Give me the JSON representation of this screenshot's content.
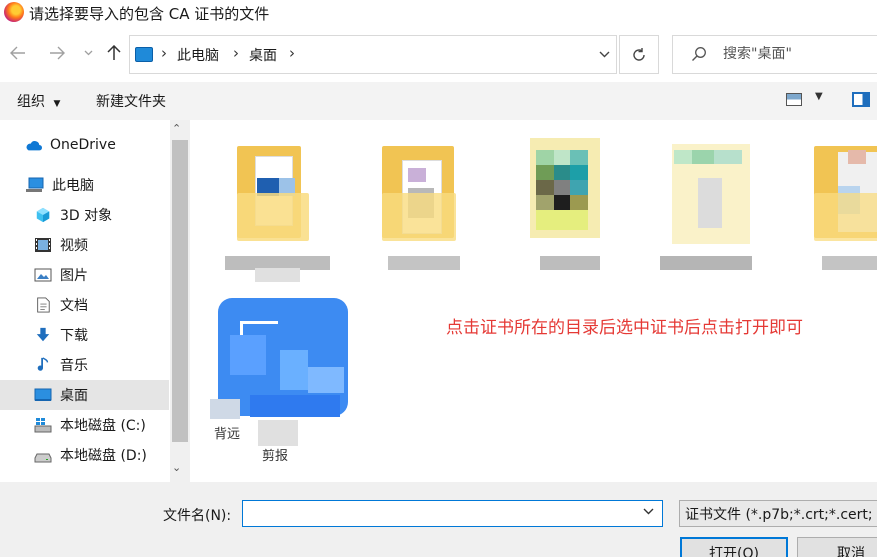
{
  "window": {
    "title": "请选择要导入的包含 CA 证书的文件"
  },
  "address": {
    "crumbs": [
      "此电脑",
      "桌面"
    ]
  },
  "search": {
    "placeholder": "搜索\"桌面\""
  },
  "toolbar": {
    "organize_label": "组织",
    "new_folder_label": "新建文件夹"
  },
  "sidebar": {
    "items": [
      {
        "label": "OneDrive",
        "icon": "onedrive-icon"
      },
      {
        "label": "此电脑",
        "icon": "computer-icon"
      },
      {
        "label": "3D 对象",
        "icon": "cube-3d-icon"
      },
      {
        "label": "视频",
        "icon": "video-icon"
      },
      {
        "label": "图片",
        "icon": "pictures-icon"
      },
      {
        "label": "文档",
        "icon": "document-icon"
      },
      {
        "label": "下载",
        "icon": "download-icon"
      },
      {
        "label": "音乐",
        "icon": "music-icon"
      },
      {
        "label": "桌面",
        "icon": "desktop-icon",
        "selected": true
      },
      {
        "label": "本地磁盘 (C:)",
        "icon": "windows-drive-icon"
      },
      {
        "label": "本地磁盘 (D:)",
        "icon": "drive-icon"
      }
    ]
  },
  "files": {
    "visible_label_fragments": [
      "",
      "",
      "",
      "",
      "",
      "背远",
      "剪报"
    ]
  },
  "annotation": {
    "hint": "点击证书所在的目录后选中证书后点击打开即可"
  },
  "footer": {
    "filename_label": "文件名(N):",
    "filename_value": "",
    "filetype_value": "证书文件 (*.p7b;*.crt;*.cert;",
    "open_label": "打开(O)",
    "cancel_label": "取消"
  }
}
